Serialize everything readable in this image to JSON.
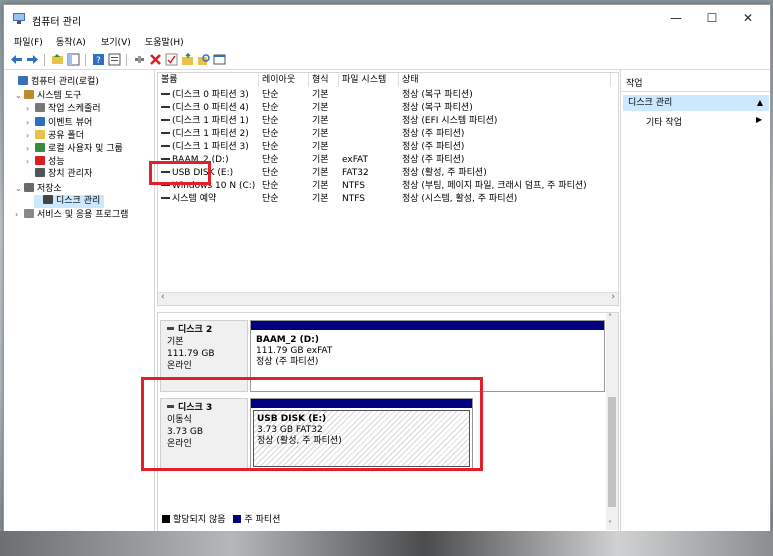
{
  "window": {
    "title": "컴퓨터 관리",
    "minimize": "—",
    "maximize": "☐",
    "close": "✕"
  },
  "menu": [
    "파일(F)",
    "동작(A)",
    "보기(V)",
    "도움말(H)"
  ],
  "tree": [
    {
      "label": "컴퓨터 관리(로컬)",
      "icon": "computer-management-icon",
      "exp": ""
    },
    {
      "label": "시스템 도구",
      "icon": "tools-icon",
      "exp": "⌄"
    },
    {
      "label": "작업 스케줄러",
      "icon": "clock-icon",
      "exp": "›"
    },
    {
      "label": "이벤트 뷰어",
      "icon": "event-viewer-icon",
      "exp": "›"
    },
    {
      "label": "공유 폴더",
      "icon": "shared-folder-icon",
      "exp": "›"
    },
    {
      "label": "로컬 사용자 및 그룹",
      "icon": "users-icon",
      "exp": "›"
    },
    {
      "label": "성능",
      "icon": "performance-icon",
      "exp": "›"
    },
    {
      "label": "장치 관리자",
      "icon": "device-manager-icon",
      "exp": ""
    },
    {
      "label": "저장소",
      "icon": "storage-icon",
      "exp": "⌄"
    },
    {
      "label": "디스크 관리",
      "icon": "disk-management-icon",
      "exp": ""
    },
    {
      "label": "서비스 및 응용 프로그램",
      "icon": "services-icon",
      "exp": "›"
    }
  ],
  "columns": [
    "볼륨",
    "레이아웃",
    "형식",
    "파일 시스템",
    "상태"
  ],
  "volumes": [
    {
      "name": "(디스크 0 파티션 3)",
      "layout": "단순",
      "type": "기본",
      "fs": "",
      "status": "정상 (복구 파티션)"
    },
    {
      "name": "(디스크 0 파티션 4)",
      "layout": "단순",
      "type": "기본",
      "fs": "",
      "status": "정상 (복구 파티션)"
    },
    {
      "name": "(디스크 1 파티션 1)",
      "layout": "단순",
      "type": "기본",
      "fs": "",
      "status": "정상 (EFI 시스템 파티션)"
    },
    {
      "name": "(디스크 1 파티션 2)",
      "layout": "단순",
      "type": "기본",
      "fs": "",
      "status": "정상 (주 파티션)"
    },
    {
      "name": "(디스크 1 파티션 3)",
      "layout": "단순",
      "type": "기본",
      "fs": "",
      "status": "정상 (주 파티션)"
    },
    {
      "name": "BAAM_2 (D:)",
      "layout": "단순",
      "type": "기본",
      "fs": "exFAT",
      "status": "정상 (주 파티션)"
    },
    {
      "name": "USB DISK (E:)",
      "layout": "단순",
      "type": "기본",
      "fs": "FAT32",
      "status": "정상 (활성, 주 파티션)"
    },
    {
      "name": "Windows 10 N (C:)",
      "layout": "단순",
      "type": "기본",
      "fs": "NTFS",
      "status": "정상 (부팅, 페이지 파일, 크래시 덤프, 주 파티션)"
    },
    {
      "name": "시스템 예약",
      "layout": "단순",
      "type": "기본",
      "fs": "NTFS",
      "status": "정상 (시스템, 활성, 주 파티션)"
    }
  ],
  "disks": [
    {
      "title": "디스크 2",
      "kind": "기본",
      "size": "111.79 GB",
      "state": "온라인",
      "partition": {
        "name": "BAAM_2  (D:)",
        "info": "111.79 GB exFAT",
        "status": "정상 (주 파티션)"
      }
    },
    {
      "title": "디스크 3",
      "kind": "이동식",
      "size": "3.73 GB",
      "state": "온라인",
      "partition": {
        "name": "USB DISK  (E:)",
        "info": "3.73 GB FAT32",
        "status": "정상 (활성, 주 파티션)"
      }
    }
  ],
  "legend": {
    "unallocated": "할당되지 않음",
    "primary": "주 파티션"
  },
  "actions": {
    "header": "작업",
    "section": "디스크 관리",
    "item": "기타 작업"
  },
  "colors": {
    "primary_partition": "#000080",
    "highlight": "#e0202a",
    "selection": "#cce8ff"
  }
}
